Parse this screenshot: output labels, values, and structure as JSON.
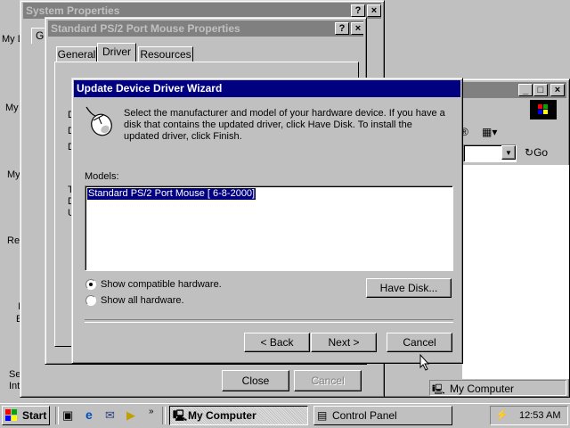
{
  "desktop": {
    "labels": [
      "My D",
      "My",
      "My",
      "Re",
      "I",
      "E",
      "Se",
      "Int"
    ]
  },
  "system_properties": {
    "title": "System Properties",
    "tab_fragment": "Ge",
    "close_label": "Close",
    "cancel_label": "Cancel"
  },
  "mouse_properties": {
    "title": "Standard PS/2 Port Mouse Properties",
    "tabs": [
      "General",
      "Driver",
      "Resources"
    ],
    "partial_lines": [
      "D",
      "D",
      "D",
      "T",
      "D",
      "U"
    ]
  },
  "explorer": {
    "go_label": "Go",
    "status_label": "My Computer"
  },
  "wizard": {
    "title": "Update Device Driver Wizard",
    "instruction": "Select the manufacturer and model of your hardware device. If you have a disk that contains the updated driver, click Have Disk. To install the updated driver, click Finish.",
    "models_label": "Models:",
    "models": [
      "Standard PS/2 Port Mouse [ 6-8-2000]"
    ],
    "radio_compatible": "Show compatible hardware.",
    "radio_all": "Show all hardware.",
    "have_disk_label": "Have Disk...",
    "back_label": "< Back",
    "next_label": "Next >",
    "cancel_label": "Cancel"
  },
  "taskbar": {
    "start_label": "Start",
    "tasks": [
      "My Computer",
      "Control Panel"
    ],
    "clock": "12:53 AM"
  }
}
